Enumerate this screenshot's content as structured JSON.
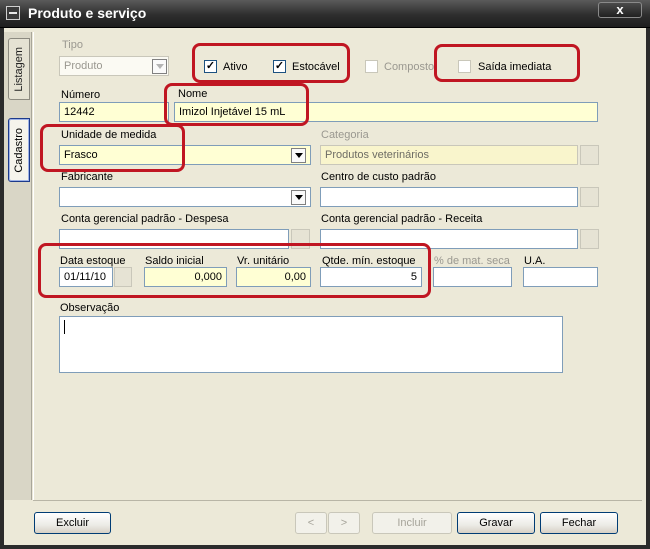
{
  "window": {
    "title": "Produto e serviço",
    "close_label": "x"
  },
  "tabs": [
    {
      "label": "Listagem"
    },
    {
      "label": "Cadastro"
    }
  ],
  "form": {
    "tipo": {
      "label": "Tipo",
      "value": "Produto"
    },
    "checkboxes": {
      "ativo": {
        "label": "Ativo",
        "checked": true
      },
      "estocavel": {
        "label": "Estocável",
        "checked": true
      },
      "composto": {
        "label": "Composto",
        "checked": false
      },
      "saida_imediata": {
        "label": "Saída imediata",
        "checked": false
      }
    },
    "check_mark": "✓",
    "numero": {
      "label": "Número",
      "value": "12442"
    },
    "nome": {
      "label": "Nome",
      "value": "Imizol Injetável  15 mL"
    },
    "unidade": {
      "label": "Unidade de medida",
      "value": "Frasco"
    },
    "categoria": {
      "label": "Categoria",
      "value": "Produtos veterinários"
    },
    "fabricante": {
      "label": "Fabricante",
      "value": ""
    },
    "centro_custo": {
      "label": "Centro de custo padrão",
      "value": ""
    },
    "conta_despesa": {
      "label": "Conta gerencial padrão - Despesa",
      "value": ""
    },
    "conta_receita": {
      "label": "Conta gerencial padrão - Receita",
      "value": ""
    },
    "data_estoque": {
      "label": "Data estoque",
      "value": "01/11/10"
    },
    "saldo_inicial": {
      "label": "Saldo inicial",
      "value": "0,000"
    },
    "vr_unitario": {
      "label": "Vr. unitário",
      "value": "0,00"
    },
    "qtde_min": {
      "label": "Qtde. mín. estoque",
      "value": "5"
    },
    "mat_seca": {
      "label": "% de mat. seca",
      "value": ""
    },
    "ua": {
      "label": "U.A.",
      "value": ""
    },
    "observacao": {
      "label": "Observação",
      "value": ""
    }
  },
  "buttons": {
    "excluir": "Excluir",
    "prev": "<",
    "next": ">",
    "incluir": "Incluir",
    "gravar": "Gravar",
    "fechar": "Fechar"
  },
  "colors": {
    "highlight": "#c01622",
    "required_field": "#ffffd4",
    "titlebar": "#2e2e2e"
  }
}
